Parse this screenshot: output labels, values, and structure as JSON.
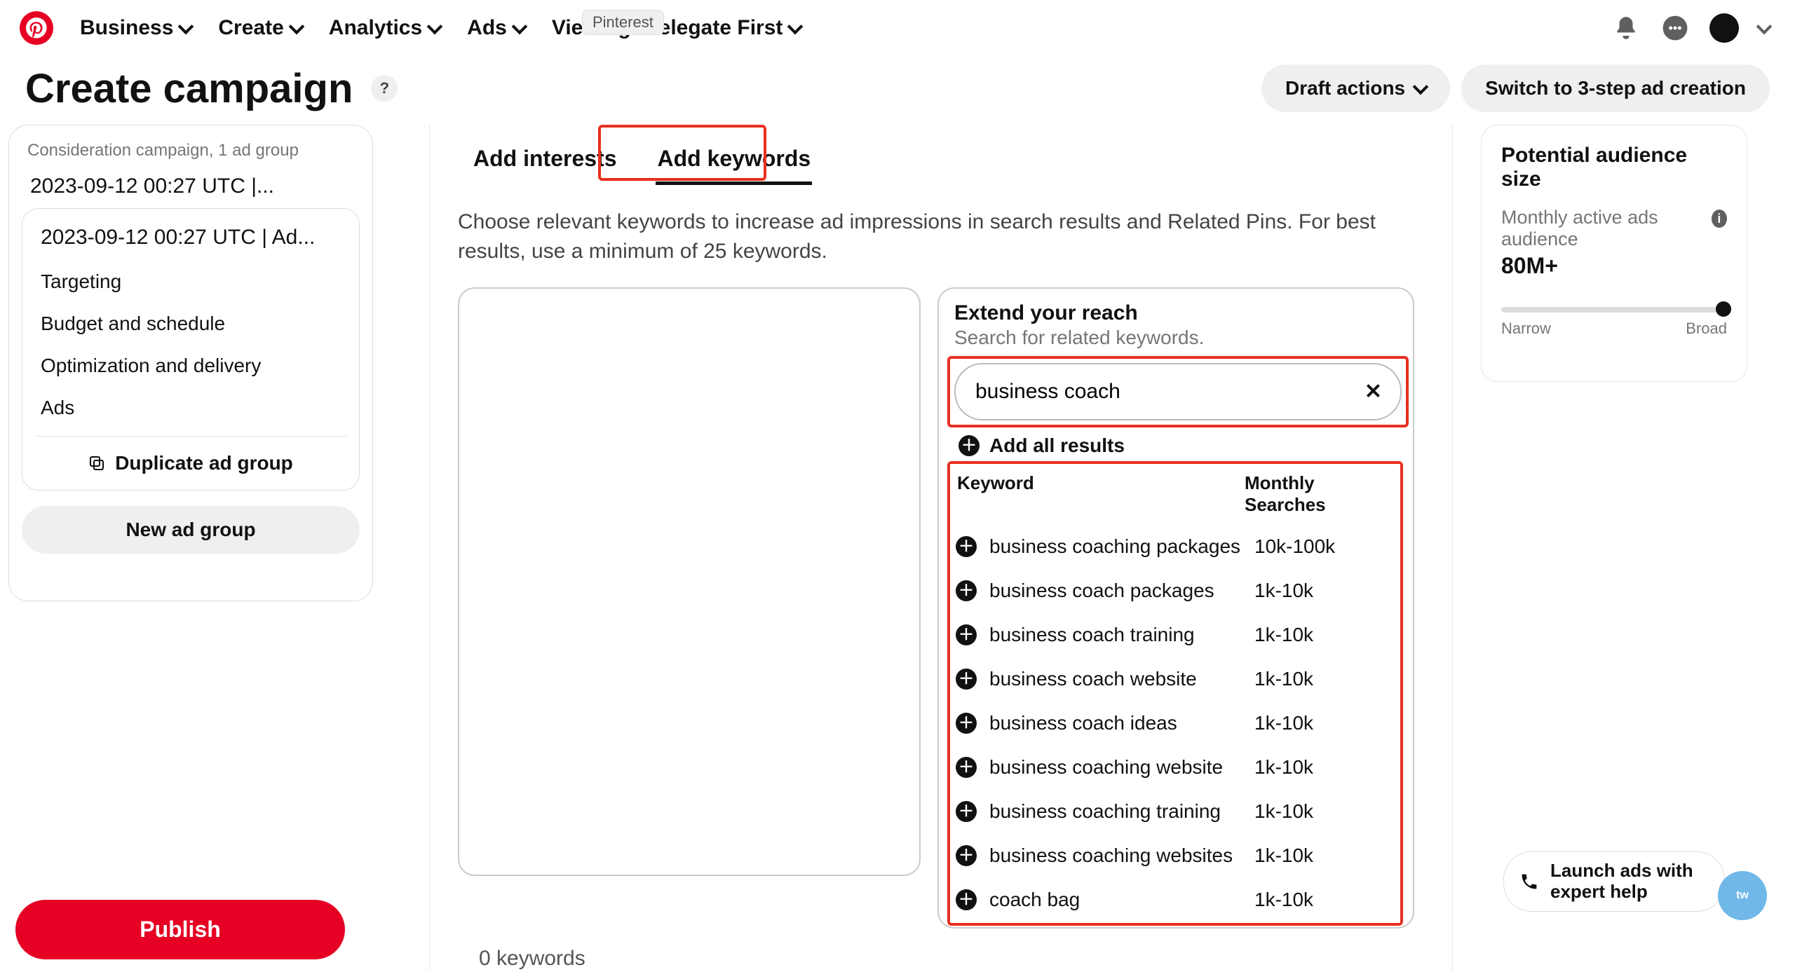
{
  "tooltip": "Pinterest",
  "nav": {
    "business": "Business",
    "create": "Create",
    "analytics": "Analytics",
    "ads": "Ads",
    "viewing": "Viewing: Delegate First"
  },
  "header": {
    "title": "Create campaign",
    "help": "?",
    "draft_actions": "Draft actions",
    "switch": "Switch to 3-step ad creation"
  },
  "sidebar": {
    "meta": "Consideration campaign, 1 ad group",
    "campaign_name": "2023-09-12 00:27 UTC |...",
    "adgroup_name": "2023-09-12 00:27 UTC | Ad...",
    "links": {
      "targeting": "Targeting",
      "budget": "Budget and schedule",
      "optimization": "Optimization and delivery",
      "ads": "Ads"
    },
    "duplicate": "Duplicate ad group",
    "newgroup": "New ad group"
  },
  "tabs": {
    "interests": "Add interests",
    "keywords": "Add keywords"
  },
  "intro": "Choose relevant keywords to increase ad impressions in search results and Related Pins. For best results, use a minimum of 25 keywords.",
  "extend": {
    "title": "Extend your reach",
    "sub": "Search for related keywords.",
    "search_value": "business coach",
    "addall": "Add all results",
    "col_kw": "Keyword",
    "col_ms": "Monthly Searches"
  },
  "keywords": [
    {
      "kw": "business coaching packages",
      "ms": "10k-100k"
    },
    {
      "kw": "business coach packages",
      "ms": "1k-10k"
    },
    {
      "kw": "business coach training",
      "ms": "1k-10k"
    },
    {
      "kw": "business coach website",
      "ms": "1k-10k"
    },
    {
      "kw": "business coach ideas",
      "ms": "1k-10k"
    },
    {
      "kw": "business coaching website",
      "ms": "1k-10k"
    },
    {
      "kw": "business coaching training",
      "ms": "1k-10k"
    },
    {
      "kw": "business coaching websites",
      "ms": "1k-10k"
    },
    {
      "kw": "coach bag",
      "ms": "1k-10k"
    }
  ],
  "count_line": "0 keywords",
  "rightcard": {
    "title": "Potential audience size",
    "sub": "Monthly active ads audience",
    "value": "80M+",
    "narrow": "Narrow",
    "broad": "Broad"
  },
  "publish": "Publish",
  "expert": "Launch ads with expert help"
}
